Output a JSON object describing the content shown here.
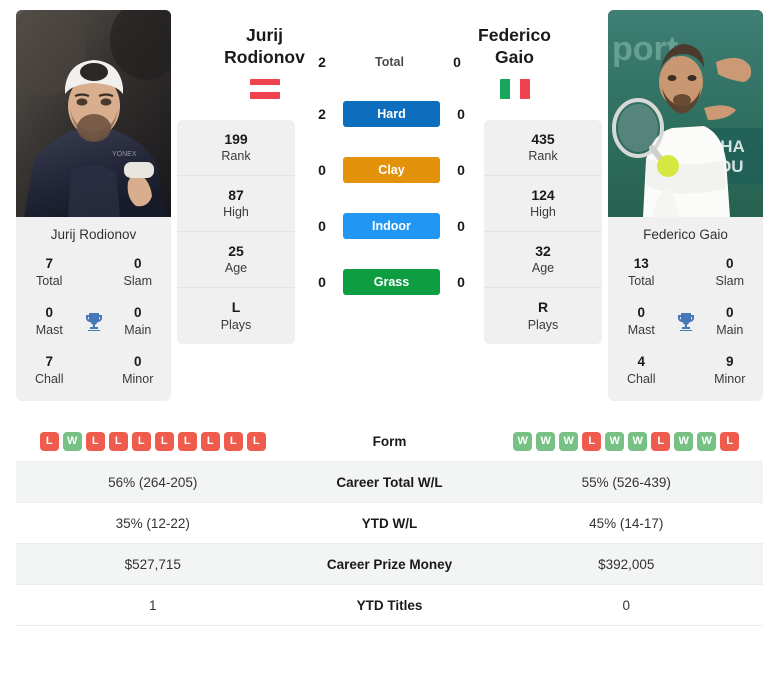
{
  "players": {
    "left": {
      "first_name": "Jurij",
      "last_name": "Rodionov",
      "full_name": "Jurij Rodionov",
      "country": "Austria",
      "flag_colors": [
        "#ef4450",
        "#ffffff",
        "#ef4450"
      ],
      "flag_orientation": "horizontal",
      "photo_alt": "Jurij Rodionov wearing white cap and dark navy shirt celebrating",
      "stats": [
        {
          "value": "199",
          "label": "Rank"
        },
        {
          "value": "87",
          "label": "High"
        },
        {
          "value": "25",
          "label": "Age"
        },
        {
          "value": "L",
          "label": "Plays"
        }
      ],
      "titles": [
        {
          "value": "7",
          "label": "Total"
        },
        {
          "value": "0",
          "label": "Slam"
        },
        {
          "value": "0",
          "label": "Mast"
        },
        {
          "value": "0",
          "label": "Main"
        },
        {
          "value": "7",
          "label": "Chall"
        },
        {
          "value": "0",
          "label": "Minor"
        }
      ],
      "form": [
        "L",
        "W",
        "L",
        "L",
        "L",
        "L",
        "L",
        "L",
        "L",
        "L"
      ],
      "career_total_wl": "56% (264-205)",
      "ytd_wl": "35% (12-22)",
      "career_prize_money": "$527,715",
      "ytd_titles": "1"
    },
    "right": {
      "first_name": "Federico",
      "last_name": "Gaio",
      "full_name": "Federico Gaio",
      "country": "Italy",
      "flag_colors": [
        "#16a75c",
        "#ffffff",
        "#ef4450"
      ],
      "flag_orientation": "vertical",
      "photo_alt": "Federico Gaio in white kit hitting a forehand on outdoor court",
      "stats": [
        {
          "value": "435",
          "label": "Rank"
        },
        {
          "value": "124",
          "label": "High"
        },
        {
          "value": "32",
          "label": "Age"
        },
        {
          "value": "R",
          "label": "Plays"
        }
      ],
      "titles": [
        {
          "value": "13",
          "label": "Total"
        },
        {
          "value": "0",
          "label": "Slam"
        },
        {
          "value": "0",
          "label": "Mast"
        },
        {
          "value": "0",
          "label": "Main"
        },
        {
          "value": "4",
          "label": "Chall"
        },
        {
          "value": "9",
          "label": "Minor"
        }
      ],
      "form": [
        "W",
        "W",
        "W",
        "L",
        "W",
        "W",
        "L",
        "W",
        "W",
        "L"
      ],
      "career_total_wl": "55% (526-439)",
      "ytd_wl": "45% (14-17)",
      "career_prize_money": "$392,005",
      "ytd_titles": "0"
    }
  },
  "head_to_head": [
    {
      "label": "Total",
      "left": "2",
      "right": "0",
      "is_badge": false,
      "color": ""
    },
    {
      "label": "Hard",
      "left": "2",
      "right": "0",
      "is_badge": true,
      "color": "#0d6ebd"
    },
    {
      "label": "Clay",
      "left": "0",
      "right": "0",
      "is_badge": true,
      "color": "#e3930b"
    },
    {
      "label": "Indoor",
      "left": "0",
      "right": "0",
      "is_badge": true,
      "color": "#2196f3"
    },
    {
      "label": "Grass",
      "left": "0",
      "right": "0",
      "is_badge": true,
      "color": "#0f9d42"
    }
  ],
  "table_rows": [
    {
      "label": "Form",
      "type": "form"
    },
    {
      "label": "Career Total W/L",
      "type": "text",
      "key": "career_total_wl"
    },
    {
      "label": "YTD W/L",
      "type": "text",
      "key": "ytd_wl"
    },
    {
      "label": "Career Prize Money",
      "type": "text",
      "key": "career_prize_money"
    },
    {
      "label": "YTD Titles",
      "type": "text",
      "key": "ytd_titles"
    }
  ],
  "icons": {
    "trophy": "trophy-icon",
    "trophy_color": "#4678b8"
  }
}
